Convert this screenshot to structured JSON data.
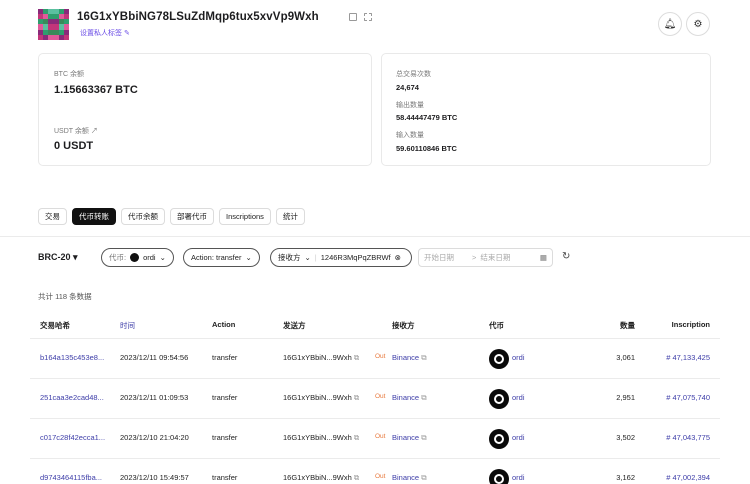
{
  "header": {
    "address": "16G1xYBbiNG78LSuZdMqp6tux5xvVp9Wxh",
    "tag_link": "设置私人标签",
    "avatar_colors": [
      "#8a2a7a",
      "#2f9e6e",
      "#5bc0a0",
      "#c2357a",
      "#e05a9a",
      "#3a8a5a"
    ],
    "bell_icon": "bell-icon",
    "user_icon": "user-settings-icon"
  },
  "balances": {
    "btc_label": "BTC 余额",
    "btc_value": "1.15663367 BTC",
    "usdt_label": "USDT 余额",
    "usdt_value": "0 USDT"
  },
  "stats": {
    "tx_count_label": "总交易次数",
    "tx_count": "24,674",
    "outputs_label": "输出数量",
    "outputs": "58.44447479 BTC",
    "inputs_label": "输入数量",
    "inputs": "59.60110846 BTC"
  },
  "tabs": [
    "交易",
    "代币转账",
    "代币余额",
    "部署代币",
    "Inscriptions",
    "统计"
  ],
  "active_tab": "代币转账",
  "filters": {
    "standard": "BRC-20",
    "token_prefix": "代币:",
    "token_value": "ordi",
    "action_label": "Action: transfer",
    "receiver_label": "接收方",
    "receiver_value": "1246R3MqPqZBRWf",
    "date_start_placeholder": "开始日期",
    "date_end_placeholder": "结束日期"
  },
  "total_text": "共计 118 条数据",
  "table": {
    "columns": [
      "交易哈希",
      "时间",
      "Action",
      "发送方",
      "接收方",
      "代币",
      "数量",
      "Inscription"
    ],
    "rows": [
      {
        "hash": "b164a135c453e8...",
        "time": "2023/12/11 09:54:56",
        "action": "transfer",
        "sender": "16G1xYBbiN...9Wxh",
        "direction": "Out",
        "receiver": "Binance",
        "token": "ordi",
        "amount": "3,061",
        "inscription": "# 47,133,425"
      },
      {
        "hash": "251caa3e2cad48...",
        "time": "2023/12/11 01:09:53",
        "action": "transfer",
        "sender": "16G1xYBbiN...9Wxh",
        "direction": "Out",
        "receiver": "Binance",
        "token": "ordi",
        "amount": "2,951",
        "inscription": "# 47,075,740"
      },
      {
        "hash": "c017c28f42ecca1...",
        "time": "2023/12/10 21:04:20",
        "action": "transfer",
        "sender": "16G1xYBbiN...9Wxh",
        "direction": "Out",
        "receiver": "Binance",
        "token": "ordi",
        "amount": "3,502",
        "inscription": "# 47,043,775"
      },
      {
        "hash": "d9743464115fba...",
        "time": "2023/12/10 15:49:57",
        "action": "transfer",
        "sender": "16G1xYBbiN...9Wxh",
        "direction": "Out",
        "receiver": "Binance",
        "token": "ordi",
        "amount": "3,162",
        "inscription": "# 47,002,394"
      }
    ]
  }
}
